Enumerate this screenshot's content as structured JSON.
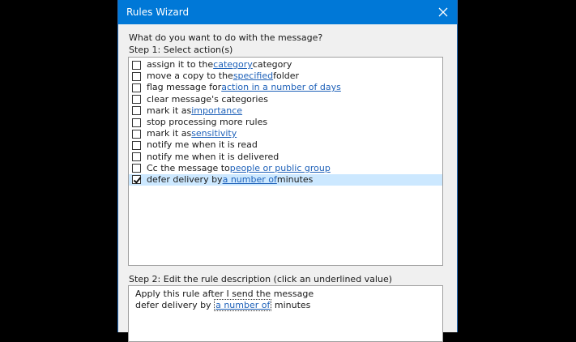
{
  "window": {
    "title": "Rules Wizard",
    "close_icon": "close-icon"
  },
  "prompt": "What do you want to do with the message?",
  "step1_label": "Step 1: Select action(s)",
  "actions": [
    {
      "pre": "assign it to the ",
      "link": "category",
      "post": " category",
      "checked": false
    },
    {
      "pre": "move a copy to the ",
      "link": "specified",
      "post": " folder",
      "checked": false
    },
    {
      "pre": "flag message for ",
      "link": "action in a number of days",
      "post": "",
      "checked": false
    },
    {
      "pre": "clear message's categories",
      "link": "",
      "post": "",
      "checked": false
    },
    {
      "pre": "mark it as ",
      "link": "importance",
      "post": "",
      "checked": false
    },
    {
      "pre": "stop processing more rules",
      "link": "",
      "post": "",
      "checked": false
    },
    {
      "pre": "mark it as ",
      "link": "sensitivity",
      "post": "",
      "checked": false
    },
    {
      "pre": "notify me when it is read",
      "link": "",
      "post": "",
      "checked": false
    },
    {
      "pre": "notify me when it is delivered",
      "link": "",
      "post": "",
      "checked": false
    },
    {
      "pre": "Cc the message to ",
      "link": "people or public group",
      "post": "",
      "checked": false
    },
    {
      "pre": "defer delivery by ",
      "link": "a number of",
      "post": " minutes",
      "checked": true,
      "selected": true
    }
  ],
  "step2_label": "Step 2: Edit the rule description (click an underlined value)",
  "description": {
    "line1": "Apply this rule after I send the message",
    "line2_pre": "defer delivery by ",
    "line2_link": "a number of",
    "line2_post": " minutes"
  }
}
